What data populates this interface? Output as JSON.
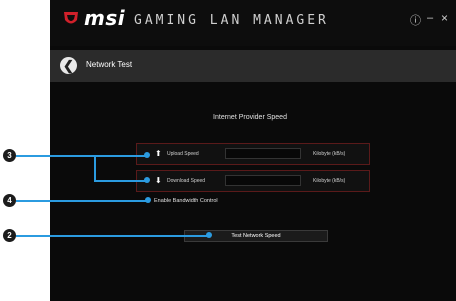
{
  "app": {
    "brand": "msi",
    "subtitle": "GAMING LAN MANAGER",
    "window_controls": {
      "info": "ⓘ",
      "minimize": "–",
      "close": "×"
    }
  },
  "header": {
    "back_glyph": "❮",
    "title": "Network Test"
  },
  "main": {
    "section_title": "Internet Provider Speed",
    "upload": {
      "icon": "upload-icon",
      "label": "Upload Speed",
      "value": "",
      "unit": "Kilobyte (kB/s)"
    },
    "download": {
      "icon": "download-icon",
      "label": "Download Speed",
      "value": "",
      "unit": "Kilobyte (kB/s)"
    },
    "bandwidth_label": "Enable Bandwidth Control",
    "test_button": "Test Network Speed"
  },
  "callouts": {
    "c3": "3",
    "c4": "4",
    "c2": "2"
  },
  "colors": {
    "accent": "#2b9be0",
    "brand_red": "#d0202a",
    "row_border": "#5a1a1a"
  }
}
